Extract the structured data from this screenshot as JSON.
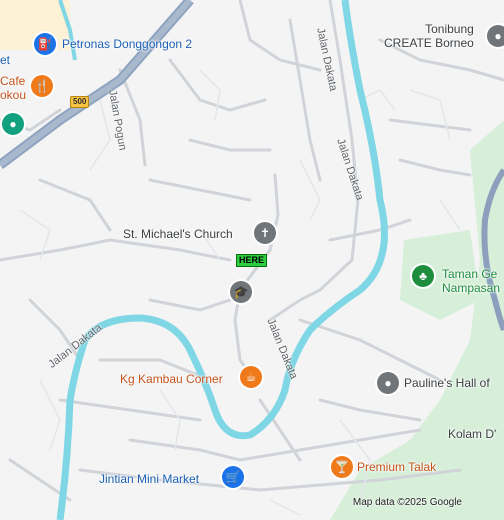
{
  "map": {
    "here_label": "HERE",
    "route_shield": "500",
    "attribution": "Map data ©2025 Google",
    "streets": [
      {
        "id": "jalan-pogun",
        "text": "Jalan Pogun"
      },
      {
        "id": "jalan-dakata-north",
        "text": "Jalan Dakata"
      },
      {
        "id": "jalan-dakata-center",
        "text": "Jalan Dakata"
      },
      {
        "id": "jalan-dakata-west",
        "text": "Jalan Dakata"
      }
    ],
    "places": [
      {
        "id": "petronas",
        "label": "Petronas Donggongon 2",
        "icon": "gas-station-icon",
        "color": "#1a73e8"
      },
      {
        "id": "cafe",
        "label_line1": "Cafe",
        "label_line2": "okou",
        "icon": "restaurant-icon",
        "color": "#f07a1a"
      },
      {
        "id": "market-top",
        "label": "et",
        "icon": "shopping-icon",
        "color": "#1a73e8"
      },
      {
        "id": "green-poi",
        "icon": "place-icon",
        "color": "#12a17e"
      },
      {
        "id": "tonibung",
        "label_line1": "Tonibung",
        "label_line2": "CREATE Borneo",
        "icon": "place-icon",
        "color": "#70757a"
      },
      {
        "id": "church",
        "label": "St. Michael's Church",
        "icon": "church-icon",
        "color": "#70757a"
      },
      {
        "id": "school",
        "icon": "school-icon",
        "color": "#70757a"
      },
      {
        "id": "taman",
        "label_line1": "Taman Ge",
        "label_line2": "Nampasan",
        "icon": "park-icon",
        "color": "#1e8e3e"
      },
      {
        "id": "kg-kambau",
        "label": "Kg Kambau Corner",
        "icon": "cafe-icon",
        "color": "#f07a1a"
      },
      {
        "id": "paulines",
        "label": "Pauline's Hall of",
        "icon": "place-icon",
        "color": "#70757a"
      },
      {
        "id": "kolam",
        "label": "Kolam D'",
        "icon": "",
        "color": "#3c4043"
      },
      {
        "id": "premium-talak",
        "label": "Premium Talak",
        "icon": "bar-icon",
        "color": "#f07a1a"
      },
      {
        "id": "jintian",
        "label": "Jintian Mini Market",
        "icon": "shopping-cart-icon",
        "color": "#1a73e8"
      }
    ]
  }
}
